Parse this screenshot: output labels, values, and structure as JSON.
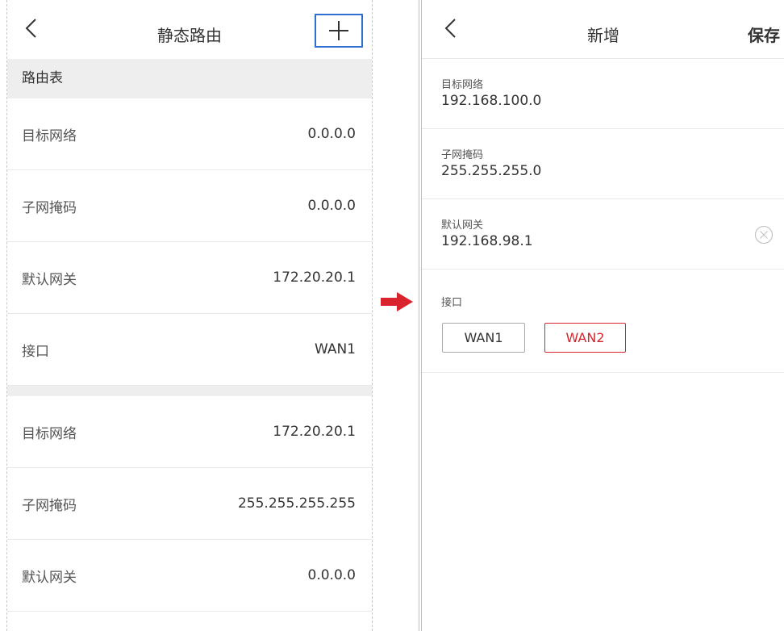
{
  "left": {
    "title": "静态路由",
    "section_title": "路由表",
    "routes": [
      {
        "rows": [
          {
            "label": "目标网络",
            "value": "0.0.0.0"
          },
          {
            "label": "子网掩码",
            "value": "0.0.0.0"
          },
          {
            "label": "默认网关",
            "value": "172.20.20.1"
          },
          {
            "label": "接口",
            "value": "WAN1"
          }
        ]
      },
      {
        "rows": [
          {
            "label": "目标网络",
            "value": "172.20.20.1"
          },
          {
            "label": "子网掩码",
            "value": "255.255.255.255"
          },
          {
            "label": "默认网关",
            "value": "0.0.0.0"
          }
        ]
      }
    ]
  },
  "right": {
    "title": "新增",
    "save_label": "保存",
    "fields": {
      "dest_network": {
        "label": "目标网络",
        "value": "192.168.100.0"
      },
      "subnet_mask": {
        "label": "子网掩码",
        "value": "255.255.255.0"
      },
      "gateway": {
        "label": "默认网关",
        "value": "192.168.98.1"
      }
    },
    "interface": {
      "label": "接口",
      "options": [
        "WAN1",
        "WAN2"
      ],
      "selected": "WAN2"
    }
  },
  "colors": {
    "accent_blue": "#2f6fd0",
    "accent_red": "#d9242e",
    "section_bg": "#eeeeee"
  },
  "icons": {
    "back": "chevron-left-icon",
    "add": "plus-icon",
    "clear": "clear-circle-icon",
    "transition_arrow": "arrow-right-icon"
  }
}
